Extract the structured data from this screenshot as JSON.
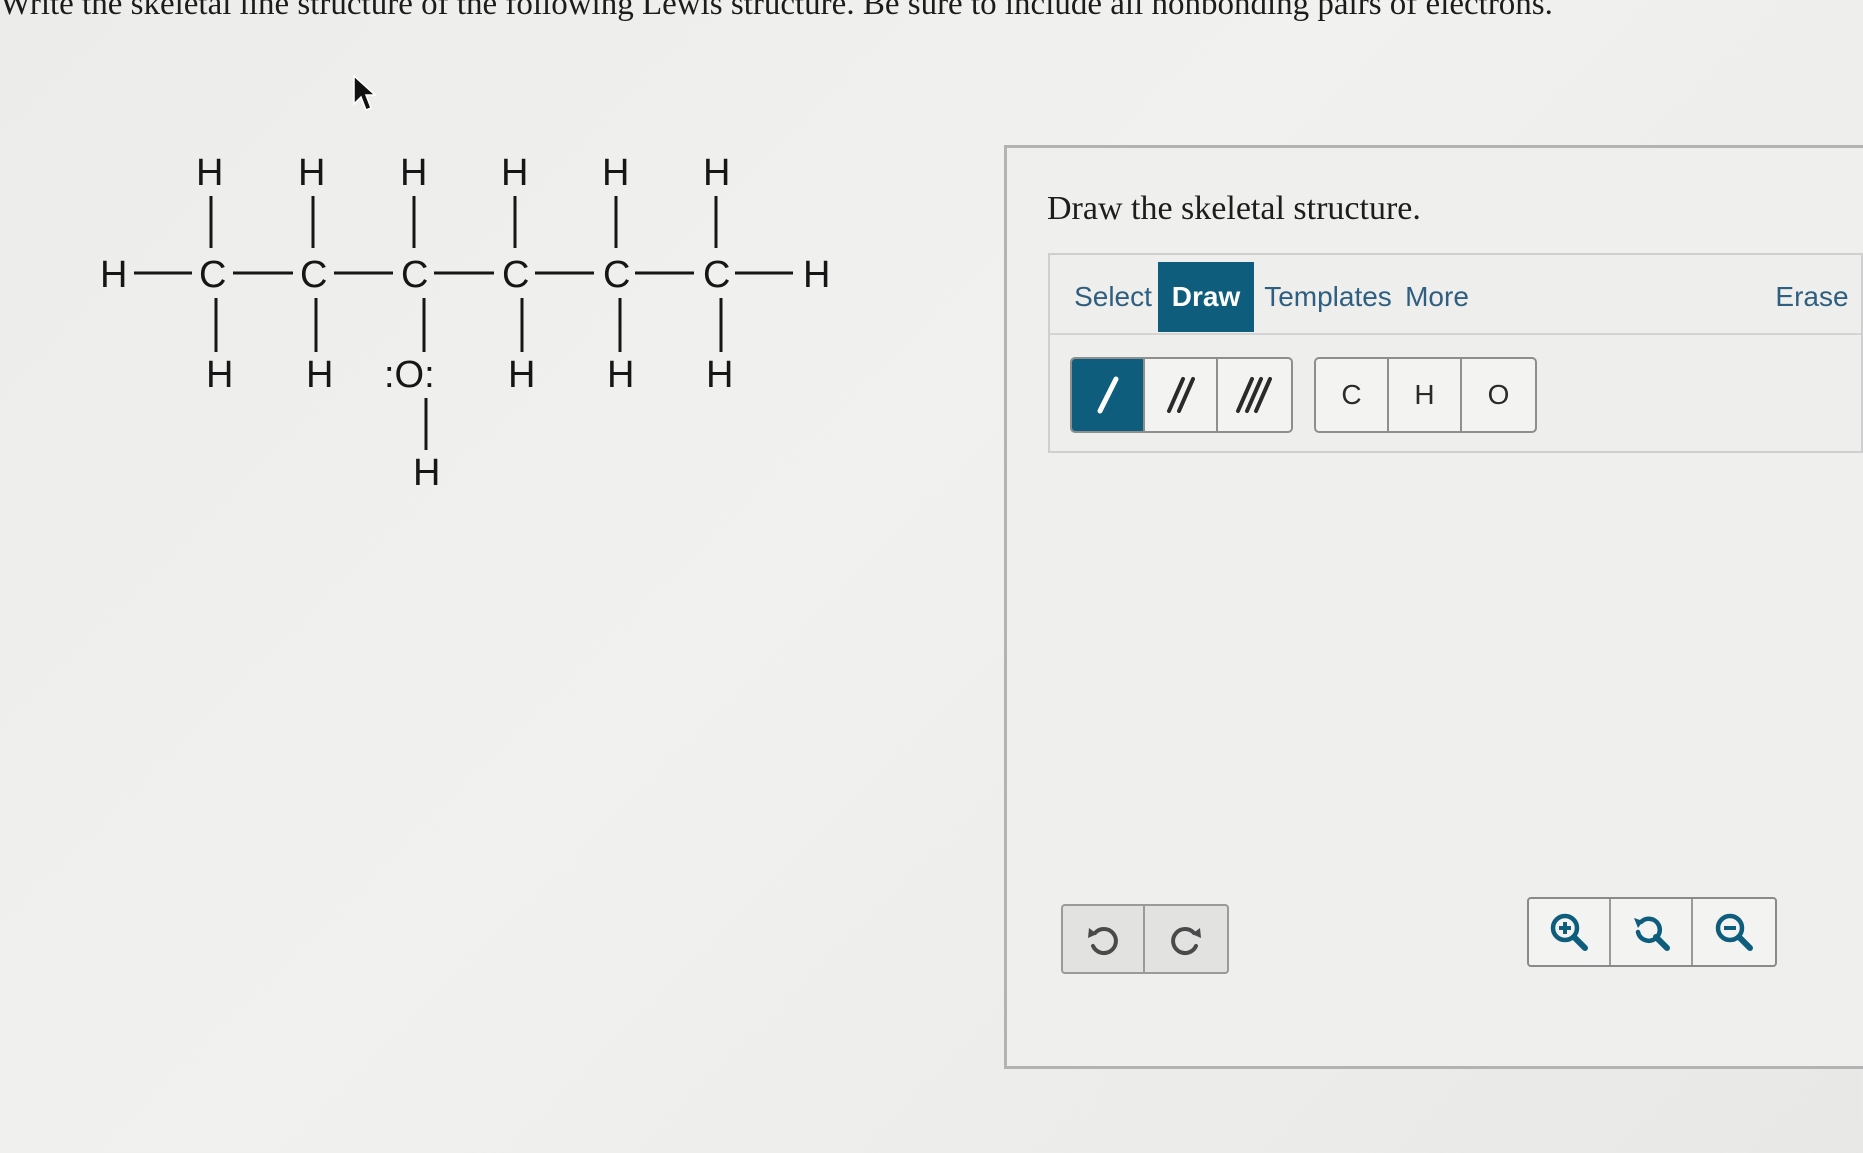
{
  "question": {
    "text": "Write the skeletal line structure of the following Lewis structure. Be sure to include all nonbonding pairs of electrons."
  },
  "lewis_structure": {
    "atoms": {
      "h_left": "H",
      "h_right": "H",
      "carbon": "C",
      "hydrogen": "H",
      "oxygen": ":O:"
    }
  },
  "panel": {
    "title": "Draw the skeletal structure."
  },
  "toolbar": {
    "tabs": {
      "select": "Select",
      "draw": "Draw",
      "templates": "Templates",
      "more": "More",
      "erase": "Erase"
    },
    "active_tab": "Draw",
    "atoms": [
      "C",
      "H",
      "O"
    ],
    "bond_icons": [
      "single-bond-icon",
      "double-bond-icon",
      "triple-bond-icon"
    ],
    "active_bond": "single-bond-icon"
  },
  "history_icons": [
    "undo-icon",
    "redo-icon"
  ],
  "zoom_icons": [
    "zoom-in-icon",
    "zoom-reset-icon",
    "zoom-out-icon"
  ],
  "colors": {
    "accent": "#0e5d7c",
    "tab_text": "#2f5f80",
    "panel_border": "#b3b3b3"
  }
}
